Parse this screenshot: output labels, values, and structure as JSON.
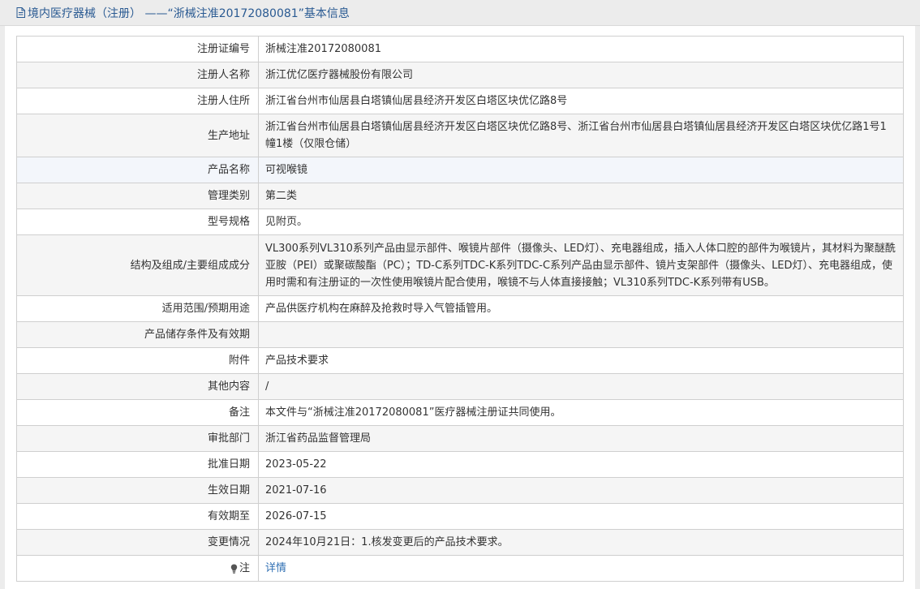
{
  "page": {
    "title": "境内医疗器械（注册） ——“浙械注准20172080081”基本信息"
  },
  "icons": {
    "title_icon": "document-icon",
    "note_icon": "lightbulb-icon"
  },
  "colors": {
    "title_text": "#2a5a92",
    "link": "#2f6fb3",
    "border": "#cfcfcf",
    "row_alt": "#f5f5f5",
    "row_highlight": "#f3f6fb"
  },
  "rows": [
    {
      "label": "注册证编号",
      "value": "浙械注准20172080081"
    },
    {
      "label": "注册人名称",
      "value": "浙江优亿医疗器械股份有限公司"
    },
    {
      "label": "注册人住所",
      "value": "浙江省台州市仙居县白塔镇仙居县经济开发区白塔区块优亿路8号"
    },
    {
      "label": "生产地址",
      "value": "浙江省台州市仙居县白塔镇仙居县经济开发区白塔区块优亿路8号、浙江省台州市仙居县白塔镇仙居县经济开发区白塔区块优亿路1号1幢1楼（仅限仓储）"
    },
    {
      "label": "产品名称",
      "value": "可视喉镜"
    },
    {
      "label": "管理类别",
      "value": "第二类"
    },
    {
      "label": "型号规格",
      "value": "见附页。"
    },
    {
      "label": "结构及组成/主要组成成分",
      "value": "VL300系列VL310系列产品由显示部件、喉镜片部件（摄像头、LED灯）、充电器组成，插入人体口腔的部件为喉镜片，其材料为聚醚酰亚胺（PEI）或聚碳酸酯（PC）；TD-C系列TDC-K系列TDC-C系列产品由显示部件、镜片支架部件（摄像头、LED灯）、充电器组成，使用时需和有注册证的一次性使用喉镜片配合使用，喉镜不与人体直接接触；VL310系列TDC-K系列带有USB。"
    },
    {
      "label": "适用范围/预期用途",
      "value": "产品供医疗机构在麻醉及抢救时导入气管插管用。"
    },
    {
      "label": "产品储存条件及有效期",
      "value": ""
    },
    {
      "label": "附件",
      "value": "产品技术要求"
    },
    {
      "label": "其他内容",
      "value": "/"
    },
    {
      "label": "备注",
      "value": "本文件与“浙械注准20172080081”医疗器械注册证共同使用。"
    },
    {
      "label": "审批部门",
      "value": "浙江省药品监督管理局"
    },
    {
      "label": "批准日期",
      "value": "2023-05-22"
    },
    {
      "label": "生效日期",
      "value": "2021-07-16"
    },
    {
      "label": "有效期至",
      "value": "2026-07-15"
    },
    {
      "label": "变更情况",
      "value": "2024年10月21日：1.核发变更后的产品技术要求。"
    }
  ],
  "note_row": {
    "label": "注",
    "link_text": "详情"
  }
}
